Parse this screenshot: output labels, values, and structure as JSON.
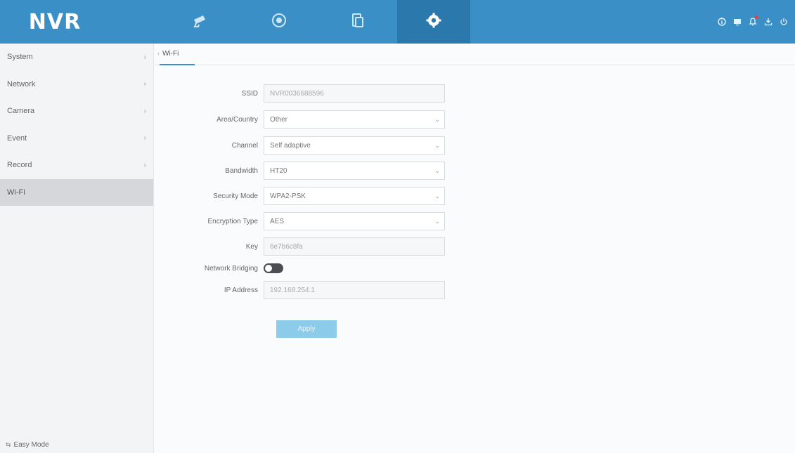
{
  "brand": {
    "logo_text": "NVR",
    "color_primary": "#3a8fc7",
    "color_active_tab": "#2b78ad"
  },
  "topnav": {
    "tabs": [
      {
        "icon": "camera-icon",
        "active": false
      },
      {
        "icon": "playback-icon",
        "active": false
      },
      {
        "icon": "files-icon",
        "active": false
      },
      {
        "icon": "gear-icon",
        "active": true
      }
    ],
    "right_icons": [
      "info-icon",
      "monitor-icon",
      "notification-icon",
      "download-icon",
      "power-icon"
    ]
  },
  "sidebar": {
    "items": [
      {
        "label": "System",
        "has_arrow": true
      },
      {
        "label": "Network",
        "has_arrow": true
      },
      {
        "label": "Camera",
        "has_arrow": true
      },
      {
        "label": "Event",
        "has_arrow": true
      },
      {
        "label": "Record",
        "has_arrow": true
      },
      {
        "label": "Wi-Fi",
        "has_arrow": false,
        "active": true
      }
    ],
    "footer": "Easy Mode"
  },
  "tabs": {
    "active": "Wi-Fi"
  },
  "form": {
    "ssid": {
      "label": "SSID",
      "value": "NVR0036688596"
    },
    "area": {
      "label": "Area/Country",
      "value": "Other"
    },
    "channel": {
      "label": "Channel",
      "value": "Self adaptive"
    },
    "bandwidth": {
      "label": "Bandwidth",
      "value": "HT20"
    },
    "security": {
      "label": "Security Mode",
      "value": "WPA2-PSK"
    },
    "encryption": {
      "label": "Encryption Type",
      "value": "AES"
    },
    "key": {
      "label": "Key",
      "value": "6e7b6c8fa"
    },
    "bridging": {
      "label": "Network Bridging",
      "enabled": false
    },
    "ip": {
      "label": "IP Address",
      "value": "192.168.254.1"
    },
    "apply_label": "Apply"
  }
}
